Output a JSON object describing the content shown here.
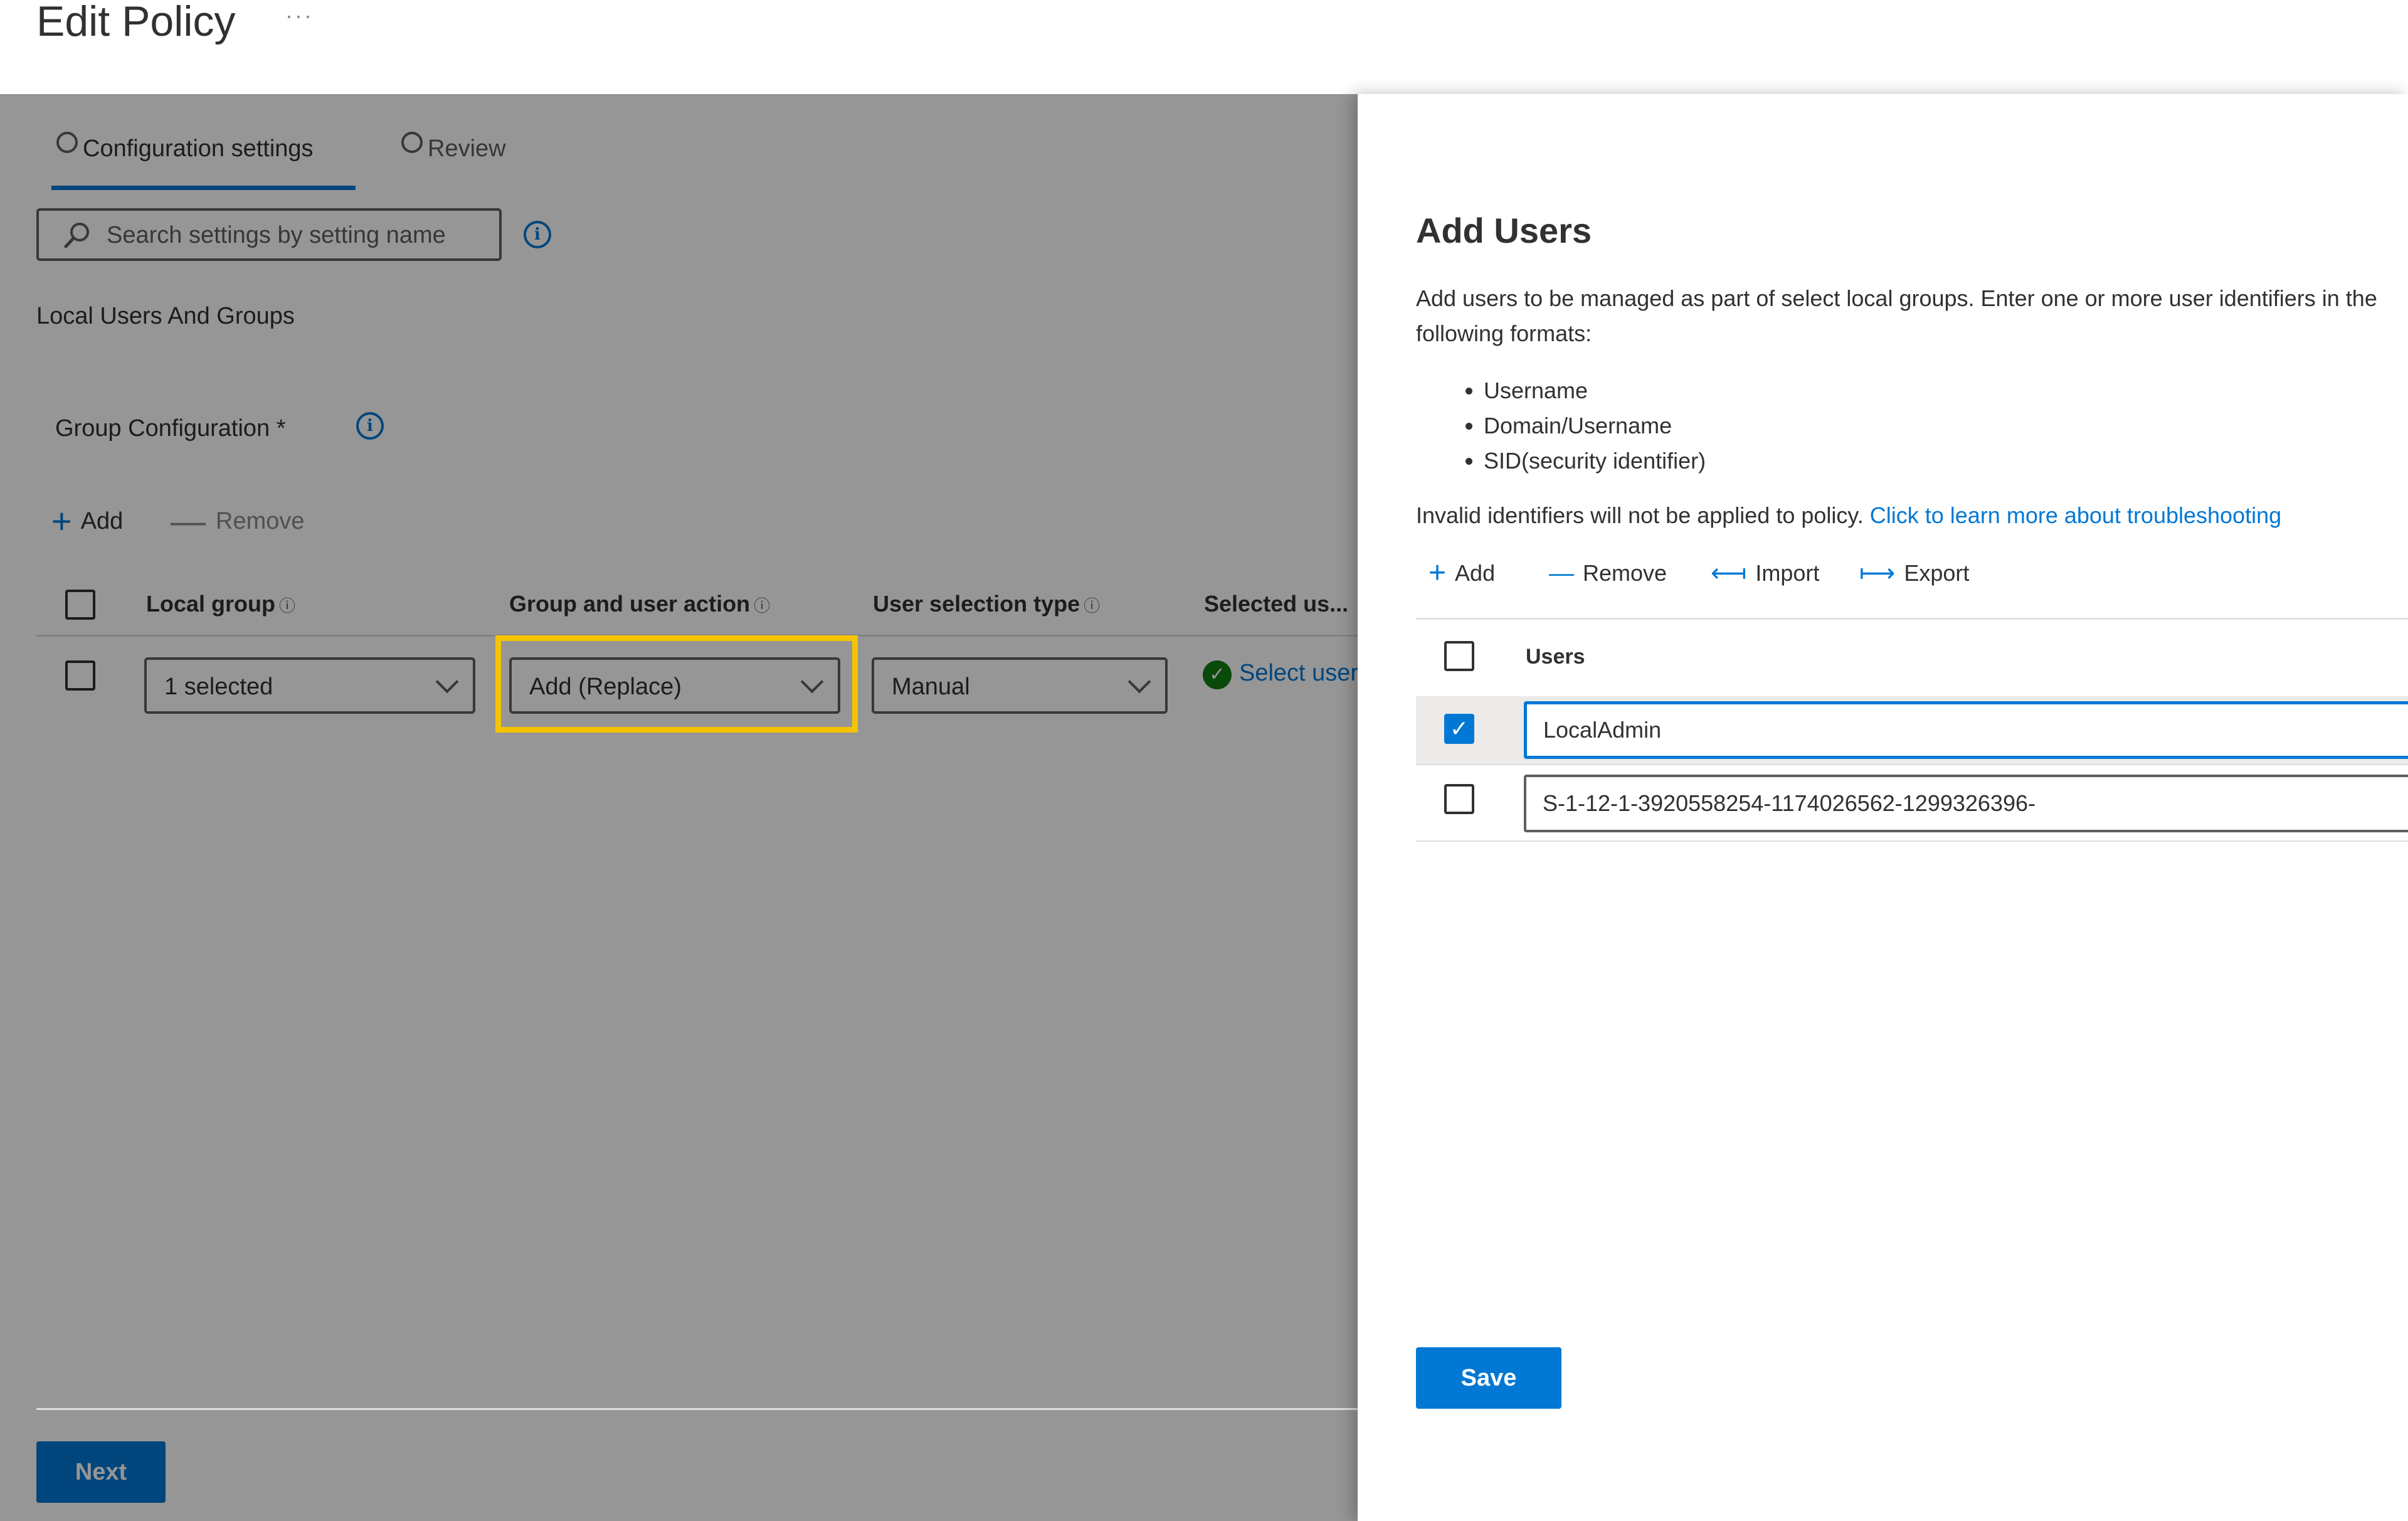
{
  "header": {
    "title": "Edit Policy",
    "more_label": "···"
  },
  "main": {
    "tabs": [
      {
        "label": "Configuration settings",
        "selected": true
      },
      {
        "label": "Review",
        "selected": false
      }
    ],
    "search": {
      "placeholder": "Search settings by setting name"
    },
    "section_label": "Local Users And Groups",
    "group_config_label": "Group Configuration *",
    "commands": {
      "add": "Add",
      "remove": "Remove"
    },
    "table": {
      "columns": [
        "Local group",
        "Group and user action",
        "User selection type",
        "Selected us..."
      ],
      "row": {
        "local_group": "1 selected",
        "action": "Add (Replace)",
        "selection_type": "Manual",
        "selected_users_link": "Select users"
      }
    },
    "next_label": "Next"
  },
  "panel": {
    "title": "Add Users",
    "description": "Add users to be managed as part of select local groups. Enter one or more user identifiers in the following formats:",
    "formats": [
      "Username",
      "Domain/Username",
      "SID(security identifier)"
    ],
    "invalid_text": "Invalid identifiers will not be applied to policy.",
    "learn_more_link": "Click to learn more about troubleshooting",
    "commands": {
      "add": "Add",
      "remove": "Remove",
      "import": "Import",
      "export": "Export"
    },
    "users_header": "Users",
    "users": [
      {
        "value": "LocalAdmin",
        "checked": true
      },
      {
        "value": "S-1-12-1-3920558254-1174026562-1299326396-",
        "checked": false
      }
    ],
    "save_label": "Save"
  },
  "colors": {
    "accent": "#0078d4",
    "highlight": "#f5c400",
    "success": "#107c10",
    "overlay": "rgba(0,0,0,0.41)"
  },
  "icons": [
    "more-icon",
    "search-icon",
    "info-icon",
    "add-icon",
    "remove-icon",
    "chevron-down-icon",
    "check-circle-icon",
    "import-icon",
    "export-icon",
    "checkmark-icon"
  ]
}
